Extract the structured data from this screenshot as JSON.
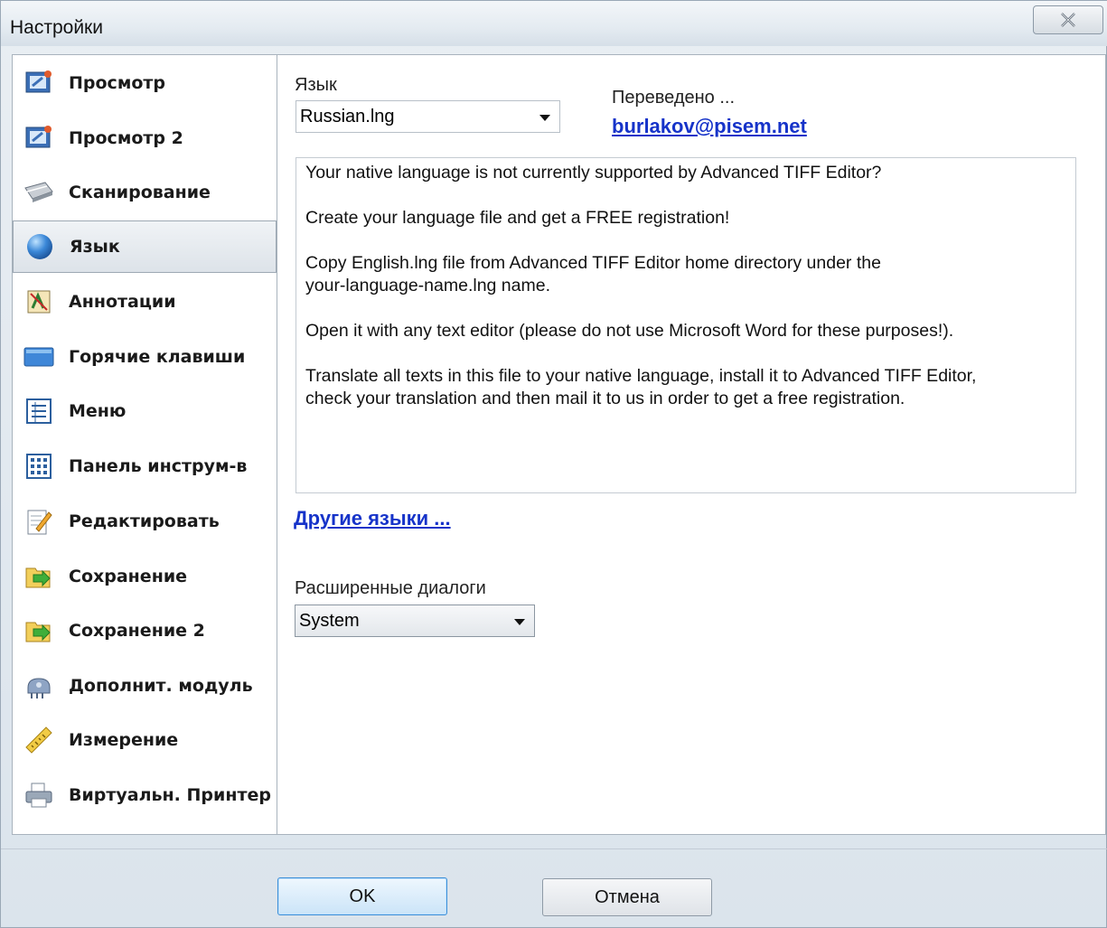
{
  "window": {
    "title": "Настройки"
  },
  "sidebar": {
    "items": [
      {
        "label": "Просмотр",
        "icon": "view-icon",
        "active": false
      },
      {
        "label": "Просмотр 2",
        "icon": "view-icon",
        "active": false
      },
      {
        "label": "Сканирование",
        "icon": "scanner-icon",
        "active": false
      },
      {
        "label": "Язык",
        "icon": "globe-icon",
        "active": true
      },
      {
        "label": "Аннотации",
        "icon": "annotation-icon",
        "active": false
      },
      {
        "label": "Горячие клавиши",
        "icon": "keyboard-icon",
        "active": false
      },
      {
        "label": "Меню",
        "icon": "menu-icon",
        "active": false
      },
      {
        "label": "Панель инструм-в",
        "icon": "toolbar-icon",
        "active": false
      },
      {
        "label": "Редактировать",
        "icon": "edit-icon",
        "active": false
      },
      {
        "label": "Сохранение",
        "icon": "save-folder-icon",
        "active": false
      },
      {
        "label": "Сохранение 2",
        "icon": "save-folder-icon",
        "active": false
      },
      {
        "label": "Дополнит. модуль",
        "icon": "plugin-icon",
        "active": false
      },
      {
        "label": "Измерение",
        "icon": "ruler-icon",
        "active": false
      },
      {
        "label": "Виртуальн. Принтер",
        "icon": "printer-icon",
        "active": false
      }
    ]
  },
  "language": {
    "label": "Язык",
    "value": "Russian.lng",
    "translated_label": "Переведено ...",
    "translator_email": "burlakov@pisem.net"
  },
  "info": {
    "paragraphs": [
      "Your native language is not currently supported by Advanced TIFF Editor?",
      "Create your language file and get a FREE registration!",
      "Copy English.lng file from Advanced TIFF Editor home directory under the\nyour-language-name.lng name.",
      "Open it with any text editor (please do not use Microsoft Word for these purposes!).",
      "Translate all texts in this file to your native language, install it to Advanced TIFF Editor,\ncheck your translation and then mail it to us  in order to get a free registration."
    ]
  },
  "other_languages_link": "Другие языки ...",
  "dialogs": {
    "label": "Расширенные диалоги",
    "value": "System"
  },
  "buttons": {
    "ok": "OK",
    "cancel": "Отмена"
  },
  "colors": {
    "link": "#1633c9",
    "accent": "#3c8fd8"
  }
}
